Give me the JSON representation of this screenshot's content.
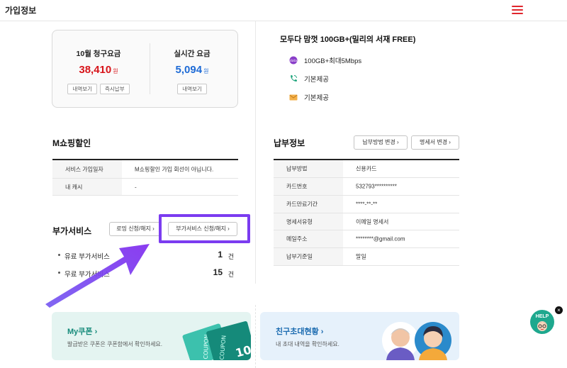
{
  "header": {
    "title": "가입정보"
  },
  "billing": {
    "monthly": {
      "label": "10월 청구요금",
      "amount": "38,410",
      "unit": "원",
      "btn_detail": "내역보기",
      "btn_pay": "즉시납부"
    },
    "realtime": {
      "label": "실시간 요금",
      "amount": "5,094",
      "unit": "원",
      "btn_detail": "내역보기"
    }
  },
  "plan": {
    "title": "모두다 맘껏 100GB+(밀리의 서재 FREE)",
    "items": [
      {
        "icon": "data-icon",
        "text": "100GB+최대5Mbps"
      },
      {
        "icon": "phone-icon",
        "text": "기본제공"
      },
      {
        "icon": "message-icon",
        "text": "기본제공"
      }
    ]
  },
  "mshopping": {
    "title": "M쇼핑할인",
    "rows": [
      {
        "label": "서비스 가입일자",
        "value": "M쇼핑할인 가입 회선이 아닙니다."
      },
      {
        "label": "내 캐시",
        "value": "-"
      }
    ]
  },
  "payment": {
    "title": "납부정보",
    "btn_method": "납부방법 변경",
    "btn_bill": "명세서 변경",
    "rows": [
      {
        "label": "납부방법",
        "value": "신용카드"
      },
      {
        "label": "카드번호",
        "value": "532793**********"
      },
      {
        "label": "카드만료기간",
        "value": "****-**-**"
      },
      {
        "label": "명세서유형",
        "value": "이메일 명세서"
      },
      {
        "label": "메일주소",
        "value": "********@gmail.com"
      },
      {
        "label": "납부기준일",
        "value": "말일"
      }
    ]
  },
  "addon": {
    "title": "부가서비스",
    "btn_roaming": "로밍 신청/해지",
    "btn_addon": "부가서비스 신청/해지",
    "items": [
      {
        "label": "유료 부가서비스",
        "count": "1",
        "unit": "건"
      },
      {
        "label": "무료 부가서비스",
        "count": "15",
        "unit": "건"
      }
    ]
  },
  "banners": {
    "coupon": {
      "title": "My쿠폰",
      "subtitle": "발급받은 쿠폰은 쿠폰함에서 확인하세요.",
      "deco_text": "COUPON",
      "deco_number": "10"
    },
    "invite": {
      "title": "친구초대현황",
      "subtitle": "내 초대 내역을 확인하세요."
    }
  },
  "help": {
    "label": "HELP"
  },
  "colors": {
    "accent_red": "#d7141a",
    "accent_blue": "#1e6bd6",
    "highlight_purple": "#7b3cf0"
  }
}
